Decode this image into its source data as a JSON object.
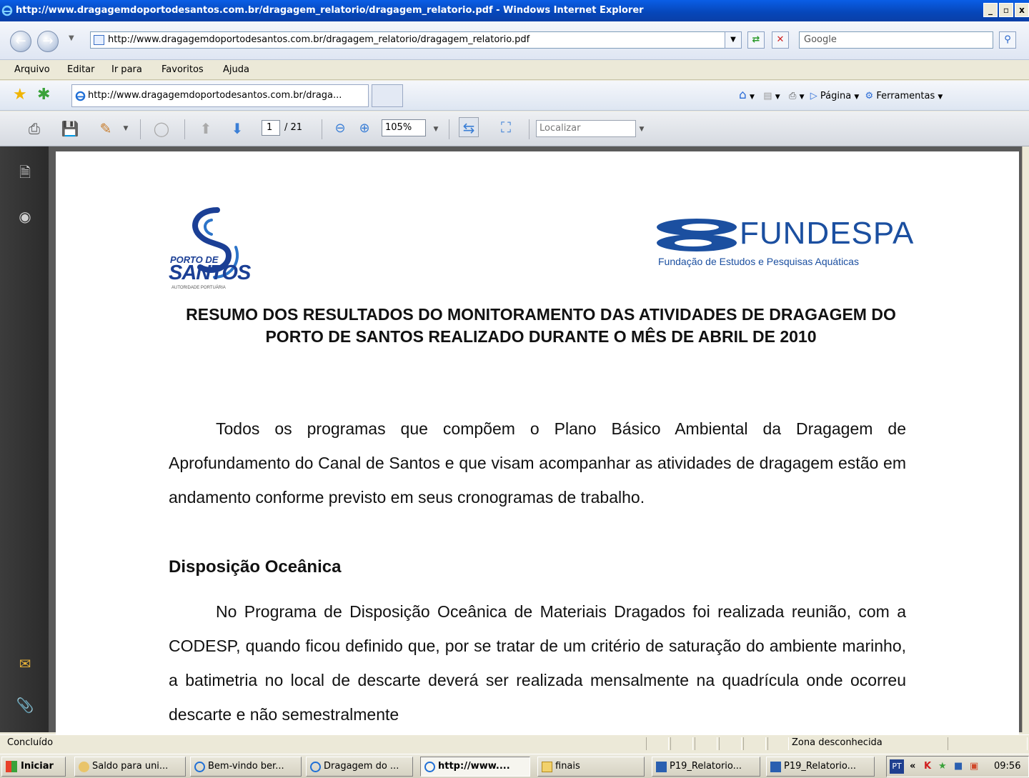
{
  "window": {
    "title": "http://www.dragagemdoportodesantos.com.br/dragagem_relatorio/dragagem_relatorio.pdf - Windows Internet Explorer",
    "controls": [
      "_",
      "▫",
      "x"
    ]
  },
  "address_bar": {
    "url": "http://www.dragagemdoportodesantos.com.br/dragagem_relatorio/dragagem_relatorio.pdf",
    "search_placeholder": "Google"
  },
  "menu": [
    "Arquivo",
    "Editar",
    "Ir para",
    "Favoritos",
    "Ajuda"
  ],
  "tabs": [
    {
      "label": "http://www.dragagemdoportodesantos.com.br/draga...",
      "active": true
    }
  ],
  "command_bar": {
    "page_label": "Página",
    "tools_label": "Ferramentas"
  },
  "pdf_toolbar": {
    "current_page": "1",
    "total_pages": "/ 21",
    "zoom": "105%",
    "find_placeholder": "Localizar"
  },
  "document": {
    "logo_left_line1": "PORTO DE",
    "logo_left_line2": "SANTOS",
    "logo_left_line3": "AUTORIDADE PORTUÁRIA",
    "logo_right_name": "FUNDESPA",
    "logo_right_subtitle": "Fundação de Estudos e Pesquisas Aquáticas",
    "title": "RESUMO DOS RESULTADOS DO MONITORAMENTO DAS ATIVIDADES DE DRAGAGEM DO PORTO DE SANTOS REALIZADO DURANTE O MÊS DE ABRIL DE 2010",
    "paragraph1": "Todos os programas que compõem o Plano Básico Ambiental da Dragagem de Aprofundamento do Canal de Santos e que visam acompanhar as atividades de dragagem estão em andamento conforme previsto em seus cronogramas de trabalho.",
    "section_heading": "Disposição Oceânica",
    "paragraph2": "No Programa de Disposição Oceânica de Materiais Dragados foi realizada reunião, com a CODESP, quando ficou definido que, por se tratar de um critério de saturação do ambiente marinho, a batimetria no local de descarte deverá ser realizada mensalmente na quadrícula onde ocorreu descarte e não semestralmente"
  },
  "status_bar": {
    "status": "Concluído",
    "zone": "Zona desconhecida"
  },
  "taskbar": {
    "start": "Iniciar",
    "buttons": [
      {
        "label": "Saldo para uni..."
      },
      {
        "label": "Bem-vindo ber..."
      },
      {
        "label": "Dragagem do ..."
      },
      {
        "label": "http://www...."
      },
      {
        "label": "finais"
      },
      {
        "label": "P19_Relatorio..."
      },
      {
        "label": "P19_Relatorio..."
      }
    ],
    "tray_lang": "PT",
    "clock": "09:56"
  },
  "colors": {
    "titlebar": "#0a5ee6",
    "brand_blue": "#1b4fa0",
    "viewer_panel": "#3c3c3c"
  }
}
